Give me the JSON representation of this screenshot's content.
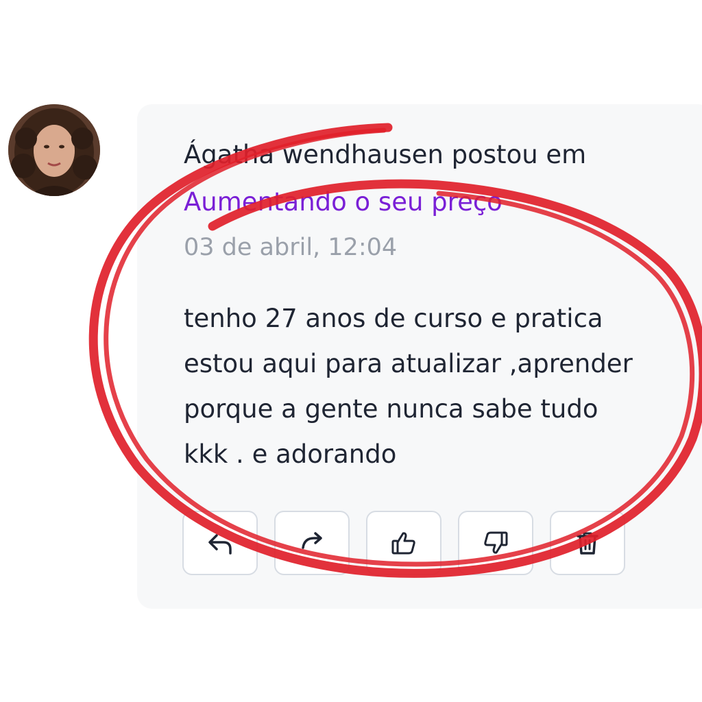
{
  "post": {
    "author": "Ágatha wendhausen",
    "verb": "postou em",
    "topic": "Aumentando o seu preço",
    "date": "03 de abril, 12:04",
    "body_lines": [
      "tenho 27 anos de curso e pratica",
      "estou aqui para atualizar ,aprender",
      "porque a gente nunca sabe tudo",
      "kkk . e adorando"
    ]
  },
  "actions": [
    {
      "icon": "reply-icon"
    },
    {
      "icon": "share-icon"
    },
    {
      "icon": "thumbs-up-icon"
    },
    {
      "icon": "thumbs-down-icon"
    },
    {
      "icon": "trash-icon"
    }
  ],
  "colors": {
    "topic_link": "#7a1fd6",
    "annotation_circle": "#e0202a",
    "card_background": "#f7f8f9"
  }
}
